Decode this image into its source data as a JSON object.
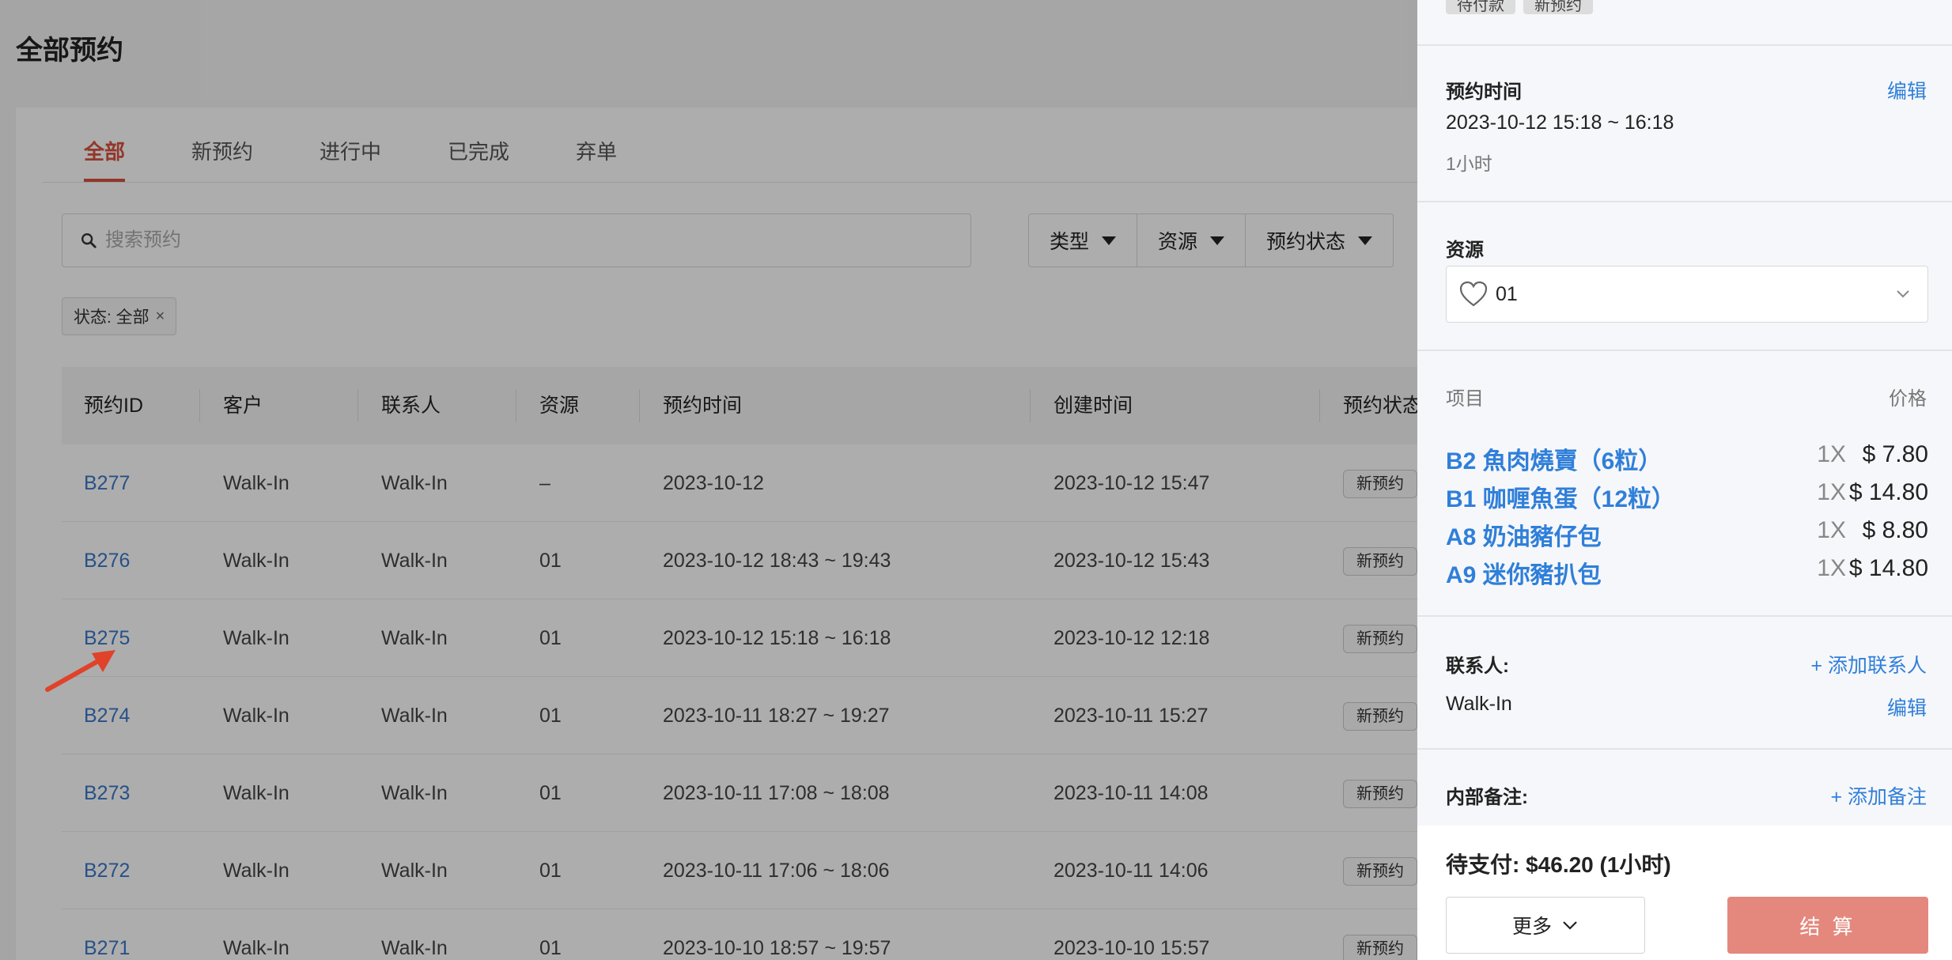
{
  "page": {
    "title": "全部预约"
  },
  "tabs": [
    {
      "label": "全部",
      "active": true
    },
    {
      "label": "新预约",
      "active": false
    },
    {
      "label": "进行中",
      "active": false
    },
    {
      "label": "已完成",
      "active": false
    },
    {
      "label": "弃单",
      "active": false
    }
  ],
  "search": {
    "placeholder": "搜索预约"
  },
  "filters": [
    "类型",
    "资源",
    "预约状态"
  ],
  "active_filter": {
    "label": "状态: 全部",
    "close": "×"
  },
  "table": {
    "columns": [
      "预约ID",
      "客户",
      "联系人",
      "资源",
      "预约时间",
      "创建时间",
      "预约状态"
    ],
    "rows": [
      {
        "id": "B277",
        "customer": "Walk-In",
        "contact": "Walk-In",
        "resource": "–",
        "time": "2023-10-12",
        "created": "2023-10-12 15:47",
        "status": "新预约"
      },
      {
        "id": "B276",
        "customer": "Walk-In",
        "contact": "Walk-In",
        "resource": "01",
        "time": "2023-10-12 18:43 ~ 19:43",
        "created": "2023-10-12 15:43",
        "status": "新预约"
      },
      {
        "id": "B275",
        "customer": "Walk-In",
        "contact": "Walk-In",
        "resource": "01",
        "time": "2023-10-12 15:18 ~ 16:18",
        "created": "2023-10-12 12:18",
        "status": "新预约"
      },
      {
        "id": "B274",
        "customer": "Walk-In",
        "contact": "Walk-In",
        "resource": "01",
        "time": "2023-10-11 18:27 ~ 19:27",
        "created": "2023-10-11 15:27",
        "status": "新预约"
      },
      {
        "id": "B273",
        "customer": "Walk-In",
        "contact": "Walk-In",
        "resource": "01",
        "time": "2023-10-11 17:08 ~ 18:08",
        "created": "2023-10-11 14:08",
        "status": "新预约"
      },
      {
        "id": "B272",
        "customer": "Walk-In",
        "contact": "Walk-In",
        "resource": "01",
        "time": "2023-10-11 17:06 ~ 18:06",
        "created": "2023-10-11 14:06",
        "status": "新预约"
      },
      {
        "id": "B271",
        "customer": "Walk-In",
        "contact": "Walk-In",
        "resource": "01",
        "time": "2023-10-10 18:57 ~ 19:57",
        "created": "2023-10-10 15:57",
        "status": "新预约"
      }
    ]
  },
  "drawer": {
    "tags": [
      "待付款",
      "新预约"
    ],
    "time_section": {
      "label": "预约时间",
      "edit": "编辑",
      "value": "2023-10-12 15:18 ~ 16:18",
      "duration": "1小时"
    },
    "resource_section": {
      "label": "资源",
      "value": "01",
      "icon": "heart-icon"
    },
    "items_section": {
      "label": "项目",
      "price_label": "价格",
      "items": [
        {
          "name": "B2 魚肉燒賣（6粒）",
          "qty": "1X",
          "price": "$ 7.80"
        },
        {
          "name": "B1 咖喱魚蛋（12粒）",
          "qty": "1X",
          "price": "$ 14.80"
        },
        {
          "name": "A8 奶油豬仔包",
          "qty": "1X",
          "price": "$ 8.80"
        },
        {
          "name": "A9 迷你豬扒包",
          "qty": "1X",
          "price": "$ 14.80"
        }
      ]
    },
    "contact_section": {
      "label": "联系人:",
      "add": "+ 添加联系人",
      "value": "Walk-In",
      "edit": "编辑"
    },
    "notes_section": {
      "label": "内部备注:",
      "add": "+ 添加备注"
    },
    "footer": {
      "pay_text": "待支付: $46.20 (1小时)",
      "more": "更多",
      "checkout": "结 算"
    }
  },
  "colors": {
    "accent": "#d9503f",
    "link": "#2f7fd9",
    "checkout": "#e4887d"
  }
}
